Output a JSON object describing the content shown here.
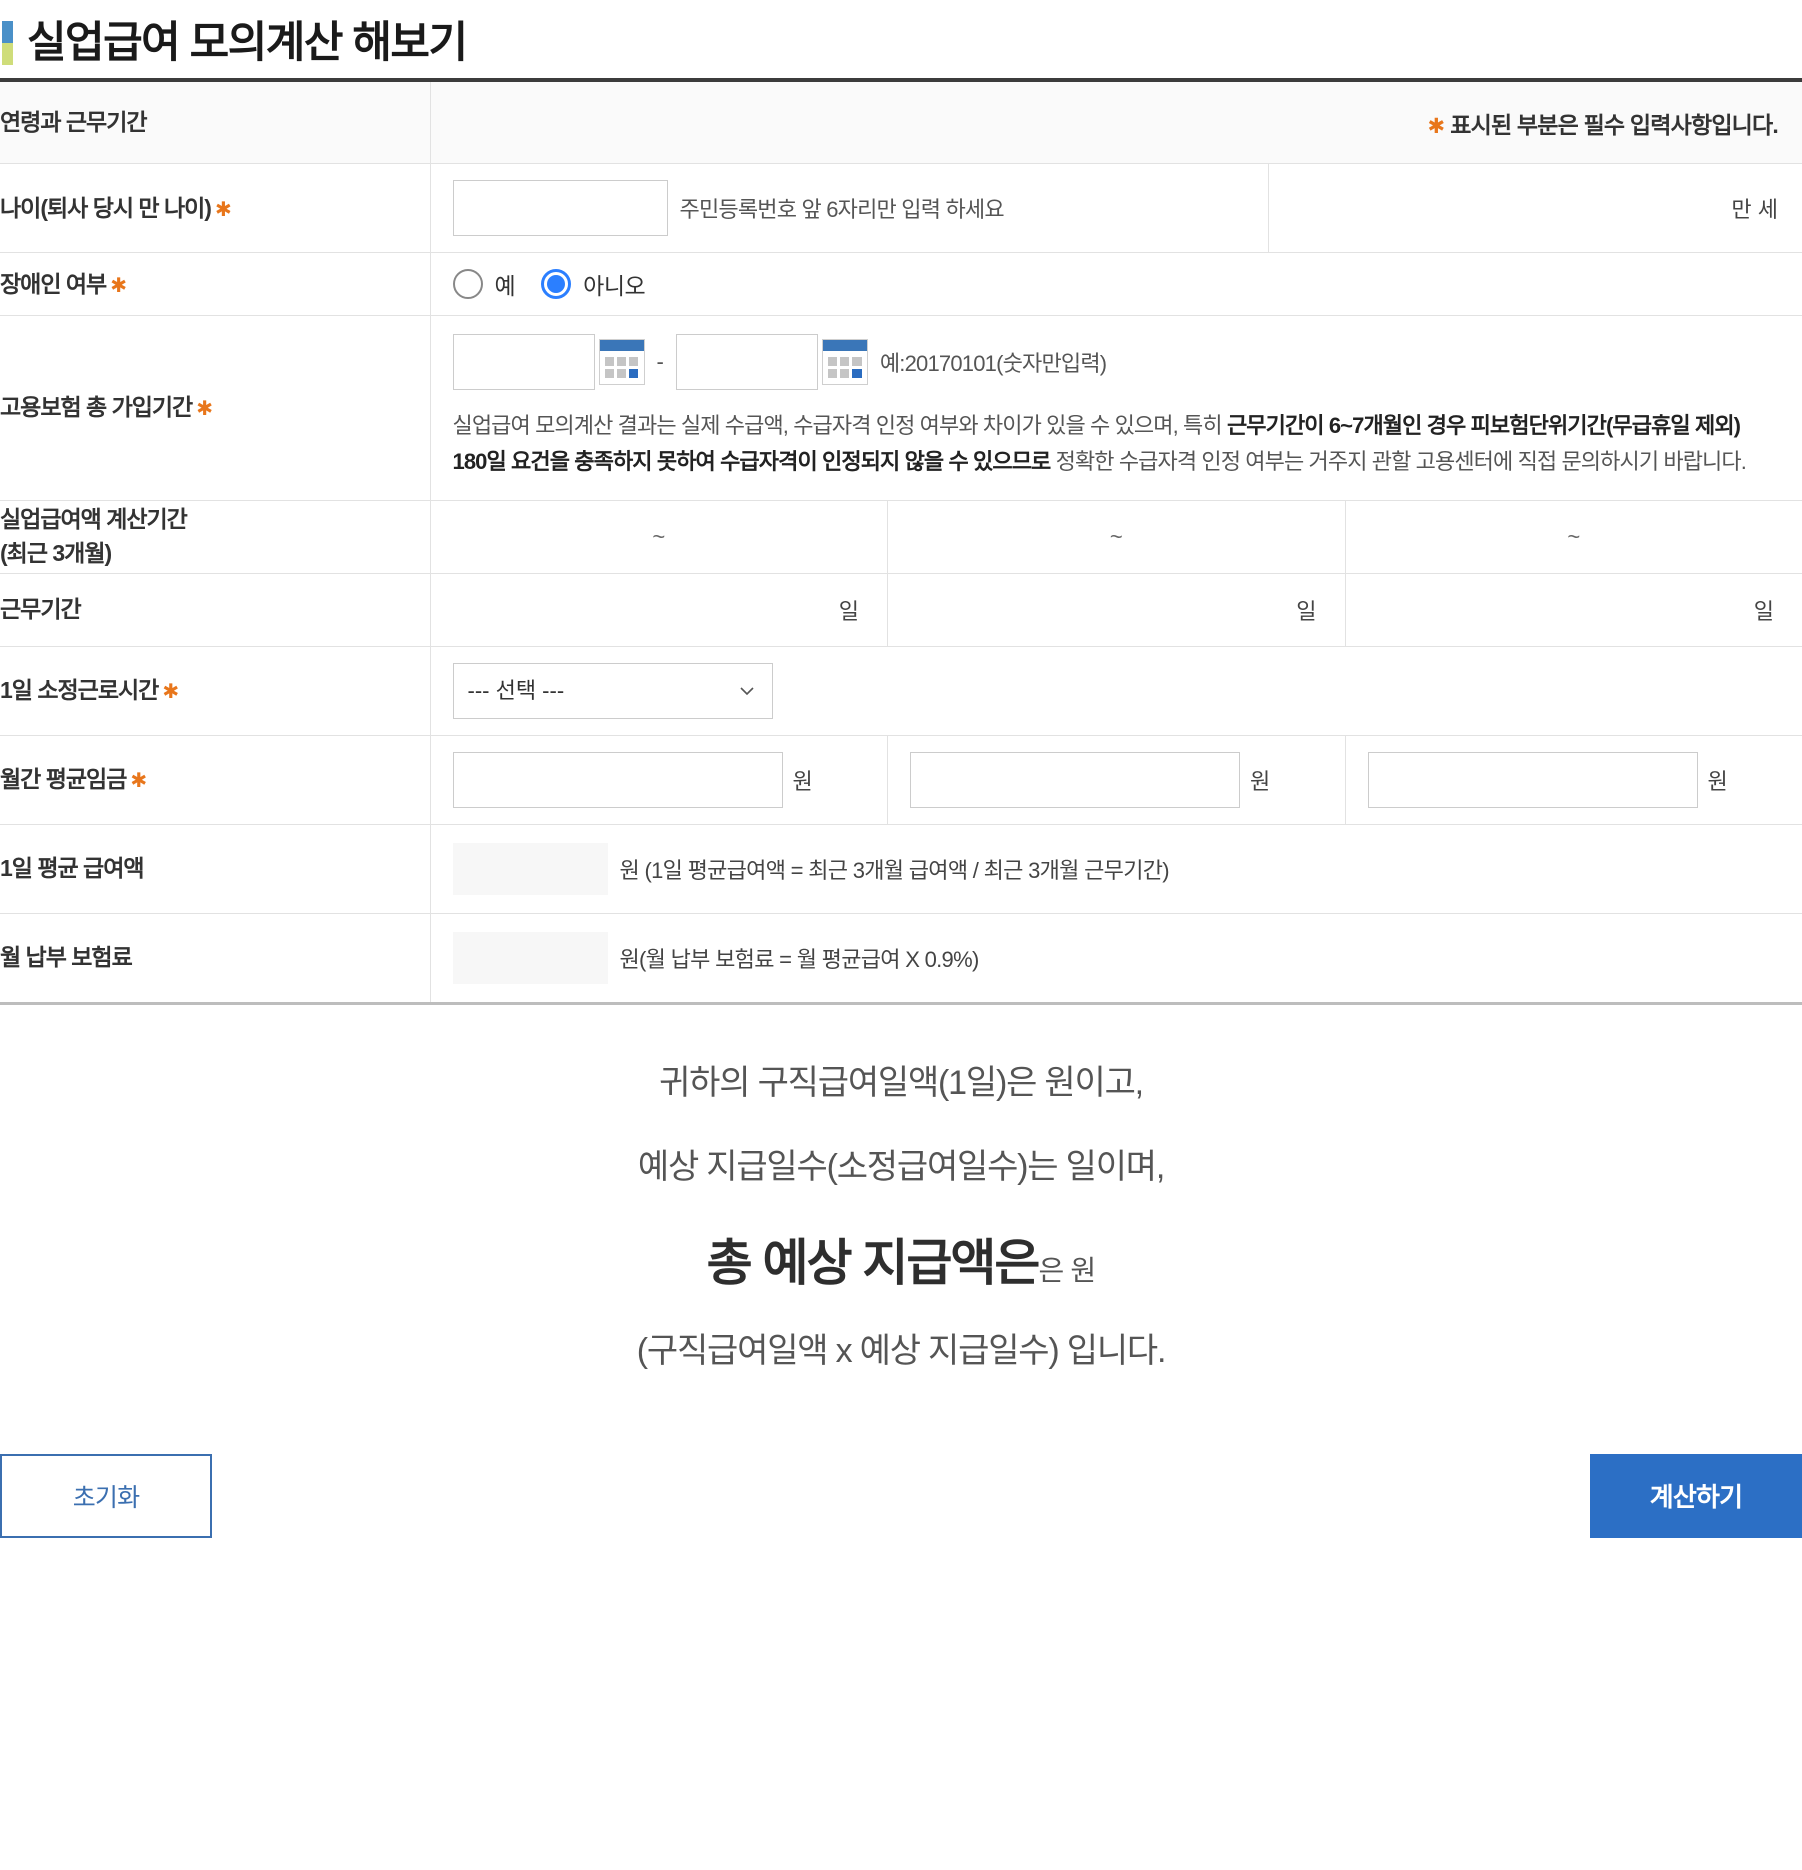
{
  "page": {
    "title": "실업급여 모의계산 해보기",
    "marker_color_top": "#4a90c8",
    "marker_color_bottom": "#cfdd7a"
  },
  "colors": {
    "required_asterisk": "#e8761b",
    "radio_selected": "#2b7fff",
    "calc_button_bg": "#2c6fc5",
    "reset_button_border": "#3b6fb0",
    "table_top_border": "#3c3c3c"
  },
  "header_row": {
    "label": "연령과 근무기간",
    "asterisk": "✱",
    "note": "표시된 부분은 필수 입력사항입니다."
  },
  "rows": {
    "age": {
      "label": "나이(퇴사 당시 만 나이)",
      "asterisk": "✱",
      "input_value": "",
      "input_placeholder": "",
      "hint": "주민등록번호 앞 6자리만 입력 하세요",
      "unit": "만 세"
    },
    "disability": {
      "label": "장애인 여부",
      "asterisk": "✱",
      "options": [
        {
          "label": "예",
          "checked": false
        },
        {
          "label": "아니오",
          "checked": true
        }
      ]
    },
    "insurance_period": {
      "label": "고용보험 총 가입기간",
      "asterisk": "✱",
      "start_value": "",
      "end_value": "",
      "separator": "-",
      "hint": "예:20170101(숫자만입력)",
      "calendar_icon": "calendar-icon",
      "notice_part1": "실업급여 모의계산 결과는 실제 수급액, 수급자격 인정 여부와 차이가 있을 수 있으며, 특히 ",
      "notice_bold": "근무기간이 6~7개월인 경우 피보험단위기간(무급휴일 제외) 180일 요건을 충족하지 못하여 수급자격이 인정되지 않을 수 있으므로",
      "notice_part2": " 정확한 수급자격 인정 여부는 거주지 관할 고용센터에 직접 문의하시기 바랍니다."
    },
    "calc_period": {
      "label_line1": "실업급여액 계산기간",
      "label_line2": "(최근 3개월)",
      "cells": [
        "~",
        "~",
        "~"
      ]
    },
    "work_period": {
      "label": "근무기간",
      "cells": [
        "일",
        "일",
        "일"
      ]
    },
    "daily_hours": {
      "label": "1일 소정근로시간",
      "asterisk": "✱",
      "selected": "--- 선택 ---",
      "options": [
        "--- 선택 ---"
      ]
    },
    "monthly_wage": {
      "label": "월간 평균임금",
      "asterisk": "✱",
      "inputs": [
        {
          "value": "",
          "unit": "원"
        },
        {
          "value": "",
          "unit": "원"
        },
        {
          "value": "",
          "unit": "원"
        }
      ]
    },
    "daily_average": {
      "label": "1일 평균 급여액",
      "value": "",
      "formula": "원 (1일 평균급여액 = 최근 3개월 급여액 / 최근 3개월 근무기간)"
    },
    "monthly_premium": {
      "label": "월 납부 보험료",
      "value": "",
      "formula": "원(월 납부 보험료 = 월 평균급여 X 0.9%)"
    }
  },
  "result": {
    "line1": "귀하의 구직급여일액(1일)은 원이고,",
    "line2": "예상 지급일수(소정급여일수)는 일이며,",
    "big_text": "총 예상 지급액은",
    "big_suffix": "은 원",
    "line4": "(구직급여일액 x 예상 지급일수) 입니다."
  },
  "buttons": {
    "reset": "초기화",
    "calculate": "계산하기"
  }
}
